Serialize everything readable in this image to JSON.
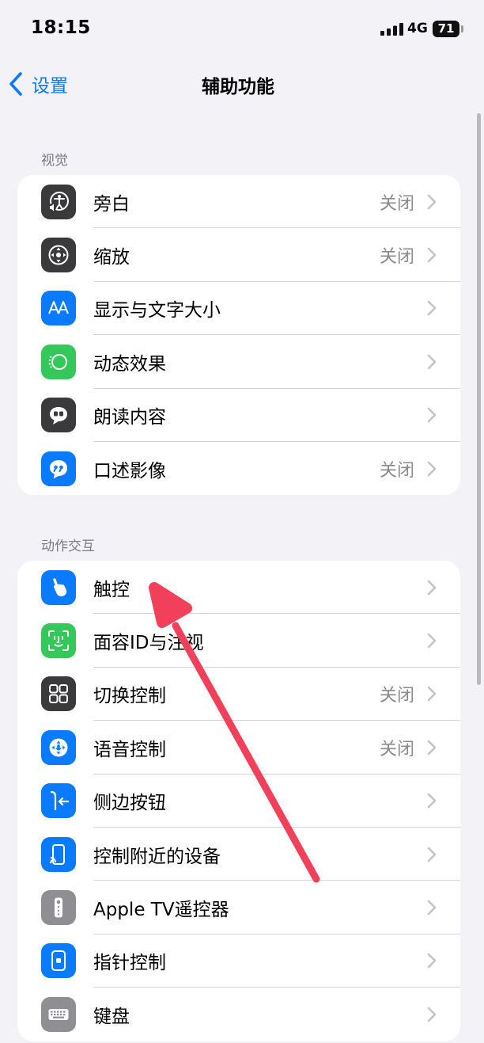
{
  "status_bar": {
    "time": "18:15",
    "network": "4G",
    "battery": "71"
  },
  "nav": {
    "back_label": "设置",
    "title": "辅助功能"
  },
  "sections": [
    {
      "header": "视觉",
      "items": [
        {
          "label": "旁白",
          "value": "关闭",
          "icon": "voiceover-icon",
          "icon_color": "#3a3a3c"
        },
        {
          "label": "缩放",
          "value": "关闭",
          "icon": "zoom-icon",
          "icon_color": "#3a3a3c"
        },
        {
          "label": "显示与文字大小",
          "value": "",
          "icon": "text-size-icon",
          "icon_color": "#0a7aff"
        },
        {
          "label": "动态效果",
          "value": "",
          "icon": "motion-icon",
          "icon_color": "#34c759"
        },
        {
          "label": "朗读内容",
          "value": "",
          "icon": "spoken-content-icon",
          "icon_color": "#3a3a3c"
        },
        {
          "label": "口述影像",
          "value": "关闭",
          "icon": "audio-description-icon",
          "icon_color": "#0a7aff"
        }
      ]
    },
    {
      "header": "动作交互",
      "items": [
        {
          "label": "触控",
          "value": "",
          "icon": "touch-icon",
          "icon_color": "#0a7aff"
        },
        {
          "label": "面容ID与注视",
          "value": "",
          "icon": "face-id-icon",
          "icon_color": "#34c759"
        },
        {
          "label": "切换控制",
          "value": "关闭",
          "icon": "switch-control-icon",
          "icon_color": "#3a3a3c"
        },
        {
          "label": "语音控制",
          "value": "关闭",
          "icon": "voice-control-icon",
          "icon_color": "#0a7aff"
        },
        {
          "label": "侧边按钮",
          "value": "",
          "icon": "side-button-icon",
          "icon_color": "#0a7aff"
        },
        {
          "label": "控制附近的设备",
          "value": "",
          "icon": "nearby-devices-icon",
          "icon_color": "#0a7aff"
        },
        {
          "label": "Apple TV遥控器",
          "value": "",
          "icon": "tv-remote-icon",
          "icon_color": "#8e8e93"
        },
        {
          "label": "指针控制",
          "value": "",
          "icon": "pointer-control-icon",
          "icon_color": "#0a7aff"
        },
        {
          "label": "键盘",
          "value": "",
          "icon": "keyboard-icon",
          "icon_color": "#8e8e93"
        }
      ]
    }
  ],
  "annotation": {
    "arrow_color": "#f2405a"
  }
}
